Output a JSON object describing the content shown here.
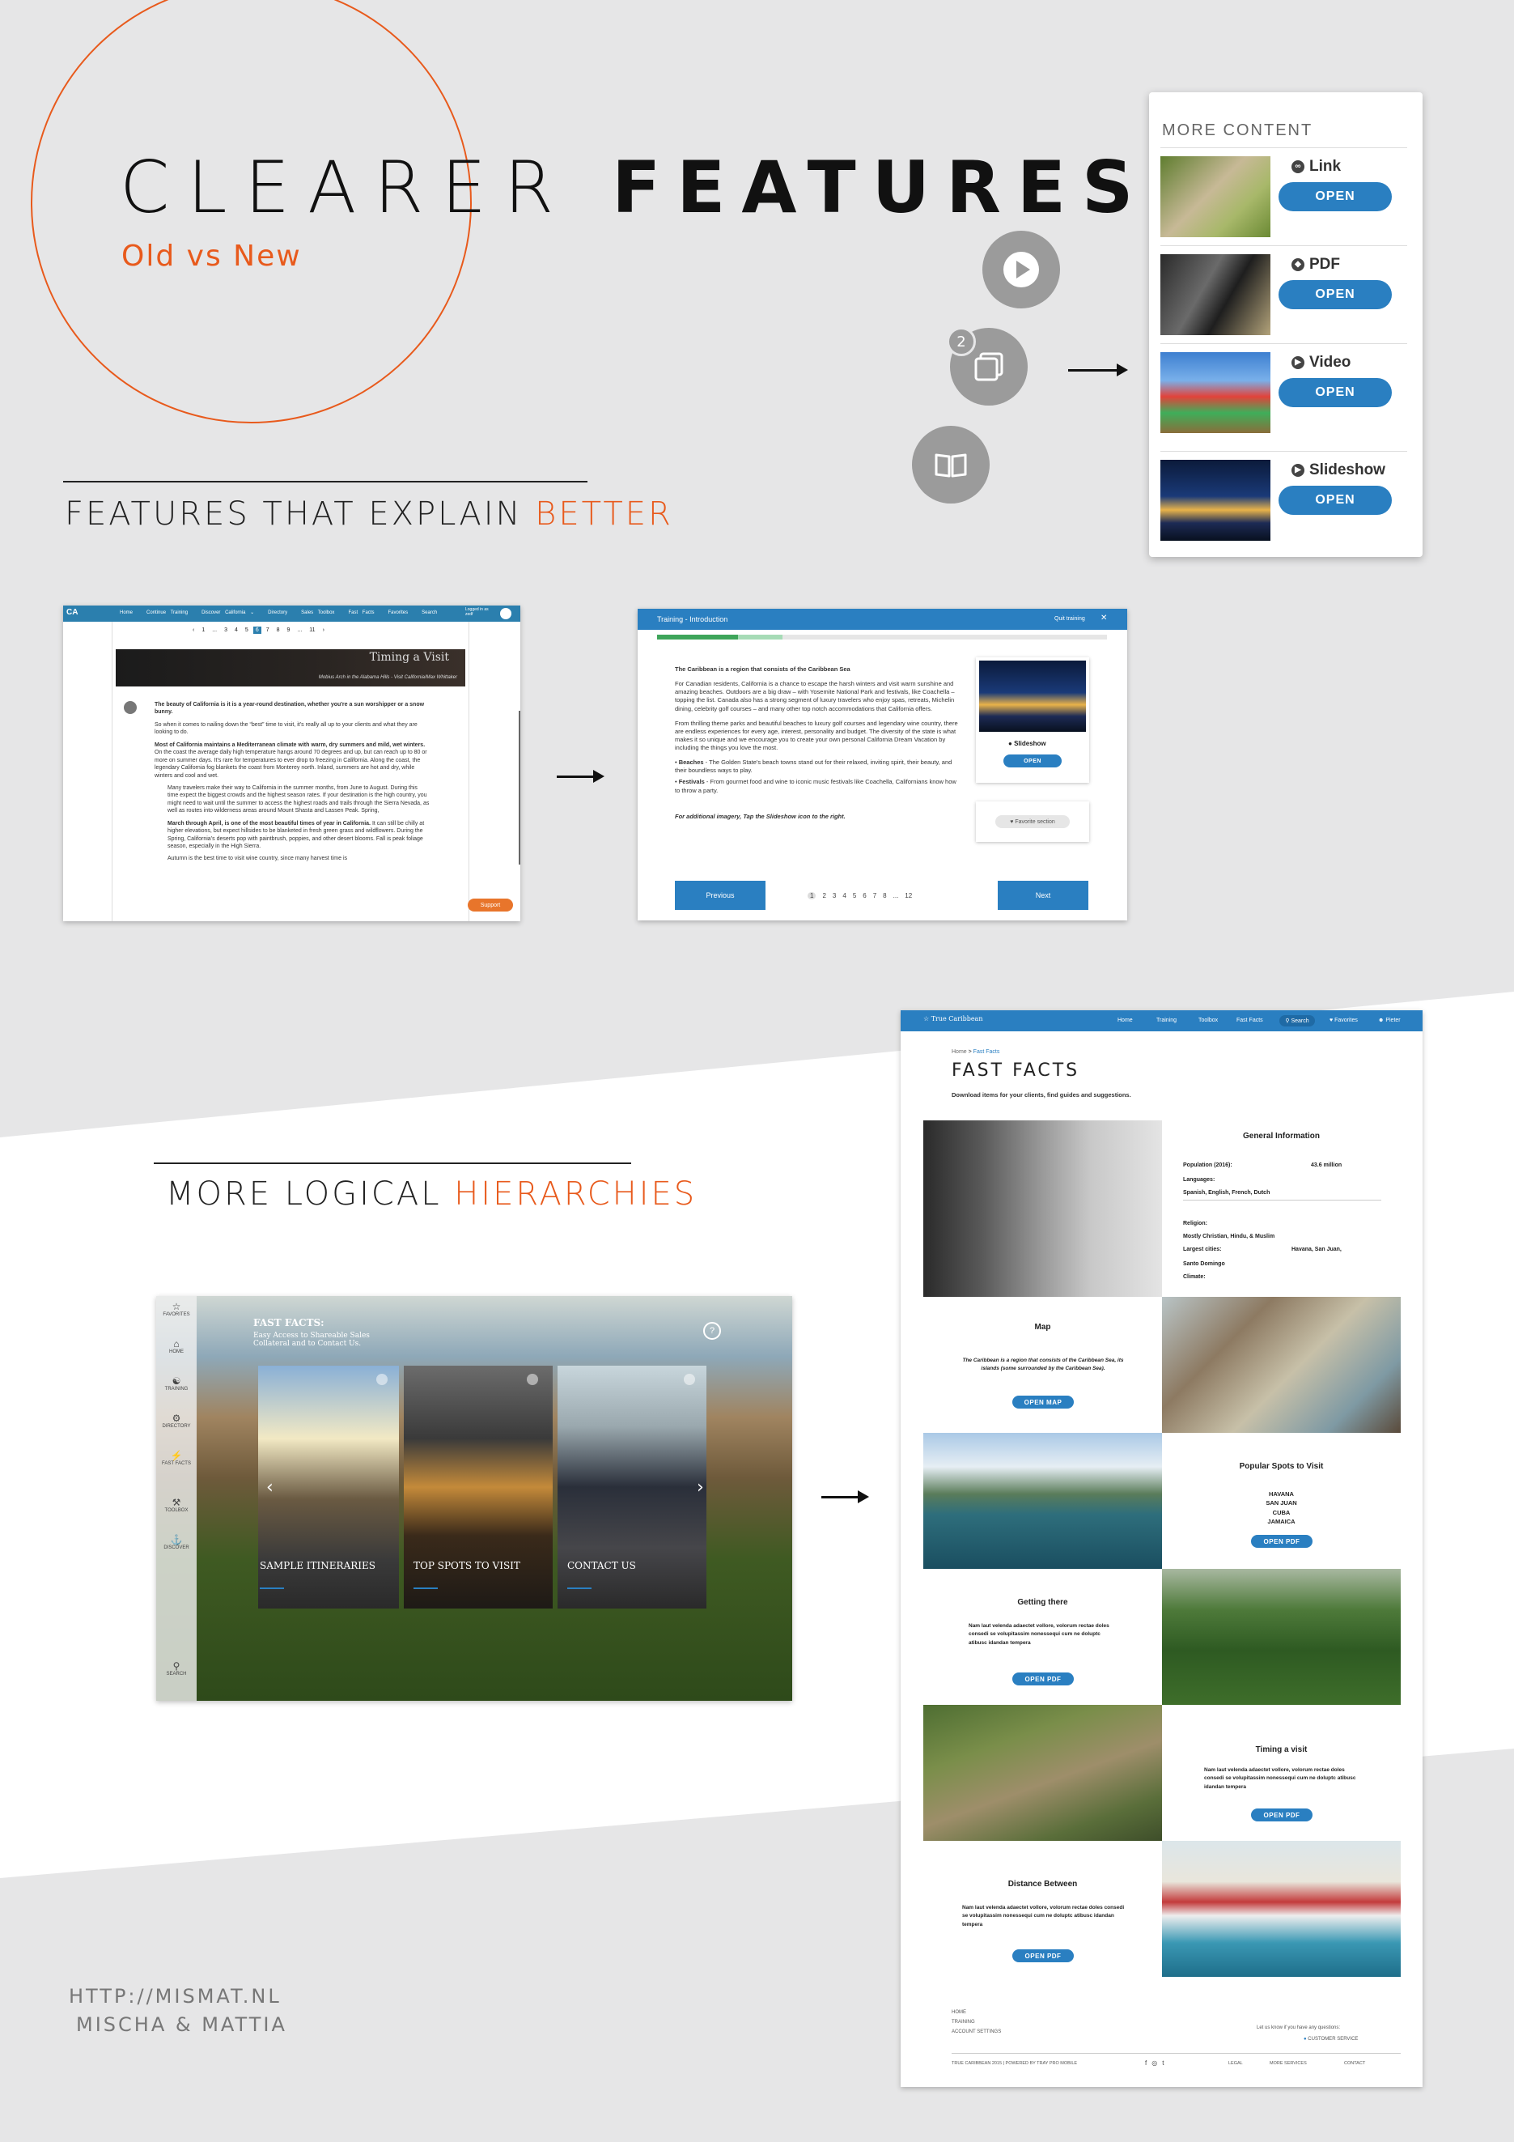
{
  "hero": {
    "title_thin": "CLEARER ",
    "title_bold": "FEATURES",
    "subtitle": "Old vs New"
  },
  "sections": {
    "explain": {
      "prefix": "FEATURES THAT EXPLAIN ",
      "highlight": "BETTER"
    },
    "hierarchy": {
      "prefix": "MORE LOGICAL ",
      "highlight": "HIERARCHIES"
    }
  },
  "media_icons": {
    "badge_count": "2"
  },
  "more_content": {
    "header": "MORE CONTENT",
    "items": [
      {
        "label": "Link",
        "icon": "link-icon",
        "button": "OPEN"
      },
      {
        "label": "PDF",
        "icon": "pdf-icon",
        "button": "OPEN"
      },
      {
        "label": "Video",
        "icon": "video-icon",
        "button": "OPEN"
      },
      {
        "label": "Slideshow",
        "icon": "slideshow-icon",
        "button": "OPEN"
      }
    ]
  },
  "old_training": {
    "nav": [
      "Home",
      "Continue Training",
      "Discover California ⌄",
      "Directory",
      "Sales Toolbox",
      "Fast Facts",
      "Favorites",
      "Search"
    ],
    "user": "Logged in as\nzedf",
    "pager": [
      "‹",
      "1",
      "...",
      "3",
      "4",
      "5",
      "6",
      "7",
      "8",
      "9",
      "...",
      "11",
      "›"
    ],
    "hero_caption": "Timing a Visit",
    "hero_credit": "Mobius Arch in the Alabama Hills - Visit California/Max Whittaker",
    "intro_bold": "The beauty of California is it is a year-round destination, whether you're a sun worshipper or a snow bunny.",
    "p1": "So when it comes to nailing down the “best” time to visit, it’s really all up to your clients and what they are looking to do.",
    "p2_bold": "Most of California maintains a Mediterranean climate with warm, dry summers and mild, wet winters.",
    "p2": " On the coast the average daily high temperature hangs around 70 degrees and up, but can reach up to 80 or more on summer days. It’s rare for temperatures to ever drop to freezing in California. Along the coast, the legendary California fog blankets the coast from Monterey north. Inland, summers are hot and dry, while winters and cool and wet.",
    "b1": "Many travelers make their way to California in the summer months, from June to August. During this time expect the biggest crowds and the highest season rates. If your destination is the high country, you might need to wait until the summer to access the highest roads and trails through the Sierra Nevada, as well as routes into wilderness areas around Mount Shasta and Lassen Peak. Spring,",
    "b2_bold": "March through April, is one of the most beautiful times of year in California.",
    "b2": " It can still be chilly at higher elevations, but expect hillsides to be blanketed in fresh green grass and wildflowers. During the Spring, California’s deserts pop with paintbrush, poppies, and other desert blooms. Fall is peak foliage season, especially in the High Sierra.",
    "b3": "Autumn is the best time to visit wine country, since many harvest time is",
    "support": "Support"
  },
  "new_training": {
    "header": "Training - Introduction",
    "quit": "Quit training",
    "lead": "The Caribbean is a region that consists of the Caribbean Sea",
    "p1": "For Canadian residents, California is a chance to escape the harsh winters and visit warm sunshine and amazing beaches. Outdoors are a big draw – with Yosemite National Park and festivals, like Coachella – topping the list. Canada also has a strong segment of luxury travelers who enjoy spas, retreats, Michelin dining, celebrity golf courses – and many other top notch accommodations that California offers.",
    "p2": "From thrilling theme parks and beautiful beaches to luxury golf courses and legendary wine country, there are endless experiences for every age, interest, personality and budget. The diversity of the state is what makes it so unique and we encourage you to create your own personal California Dream Vacation by including the things you love the most.",
    "b1_bold": "Beaches",
    "b1": " - The Golden State's beach towns stand out for their relaxed, inviting spirit, their beauty, and their boundless ways to play.",
    "b2_bold": "Festivals",
    "b2": " - From gourmet food and wine to iconic music festivals like Coachella, Californians know how to throw a party.",
    "note": "For additional imagery, Tap the Slideshow icon to the right.",
    "side_label": "Slideshow",
    "side_btn": "OPEN",
    "fav": "Favorite section",
    "prev": "Previous",
    "next": "Next",
    "pages": [
      "1",
      "2",
      "3",
      "4",
      "5",
      "6",
      "7",
      "8",
      "...",
      "12"
    ]
  },
  "old_fastfacts": {
    "sidebar": [
      "FAVORITES",
      "HOME",
      "TRAINING",
      "DIRECTORY",
      "FAST FACTS",
      "TOOLBOX",
      "DISCOVER",
      "SEARCH"
    ],
    "title": "FAST FACTS:",
    "subtitle": "Easy Access to Shareable Sales Collateral and to Contact Us.",
    "help": "?",
    "tiles": [
      "SAMPLE ITINERARIES",
      "TOP SPOTS TO VISIT",
      "CONTACT US"
    ]
  },
  "new_fastfacts": {
    "brand": "True Caribbean",
    "nav": [
      "Home",
      "Training",
      "Toolbox",
      "Fast Facts",
      "Search",
      "Favorites",
      "Pieter"
    ],
    "breadcrumb_home": "Home",
    "breadcrumb_current": "Fast Facts",
    "title": "FAST FACTS",
    "desc": "Download items for your clients, find guides and suggestions.",
    "general": {
      "title": "General Information",
      "population_label": "Population (2016):",
      "population_value": "43.6 million",
      "languages_label": "Languages:",
      "languages_value": "Spanish, English, French, Dutch",
      "religion_label": "Religion:",
      "religion_value": "Mostly Christian, Hindu, & Muslim",
      "cities_label": "Largest cities:",
      "cities_value": "Havana, San Juan,",
      "cities_value2": "Santo Domingo",
      "climate_label": "Climate:"
    },
    "map": {
      "title": "Map",
      "text_bold": "The Caribbean",
      "text": " is a region that consists of the Caribbean Sea, its islands (some surrounded by the Caribbean Sea).",
      "button": "OPEN MAP"
    },
    "spots": {
      "title": "Popular Spots to Visit",
      "list": [
        "HAVANA",
        "SAN JUAN",
        "CUBA",
        "JAMAICA"
      ],
      "button": "OPEN PDF"
    },
    "getting": {
      "title": "Getting there",
      "text": "Nam laut velenda adaectet vollore, volorum rectae doles consedi se volupitassim nonessequi cum ne doluptc atibusc idandan tempera",
      "button": "OPEN PDF"
    },
    "timing": {
      "title": "Timing a visit",
      "text": "Nam laut velenda adaectet vollore, volorum rectae doles consedi se volupitassim nonessequi cum ne doluptc atibusc idandan tempera",
      "button": "OPEN PDF"
    },
    "distance": {
      "title": "Distance Between",
      "text": "Nam laut velenda adaectet vollore, volorum rectae doles consedi se volupitassim nonessequi cum ne doluptc atibusc idandan tempera",
      "button": "OPEN PDF"
    },
    "footer": {
      "links": [
        "HOME",
        "TRAINING",
        "ACCOUNT SETTINGS"
      ],
      "question": "Let us know if you have any questions:",
      "service": "CUSTOMER SERVICE",
      "copyright": "TRUE CARIBBEAN 2015 | POWERED BY TRAY PRO MOBILE",
      "legal": [
        "LEGAL",
        "MORE SERVICES",
        "CONTACT"
      ]
    }
  },
  "credits": {
    "url": "HTTP://MISMAT.NL",
    "names": "MISCHA & MATTIA"
  }
}
